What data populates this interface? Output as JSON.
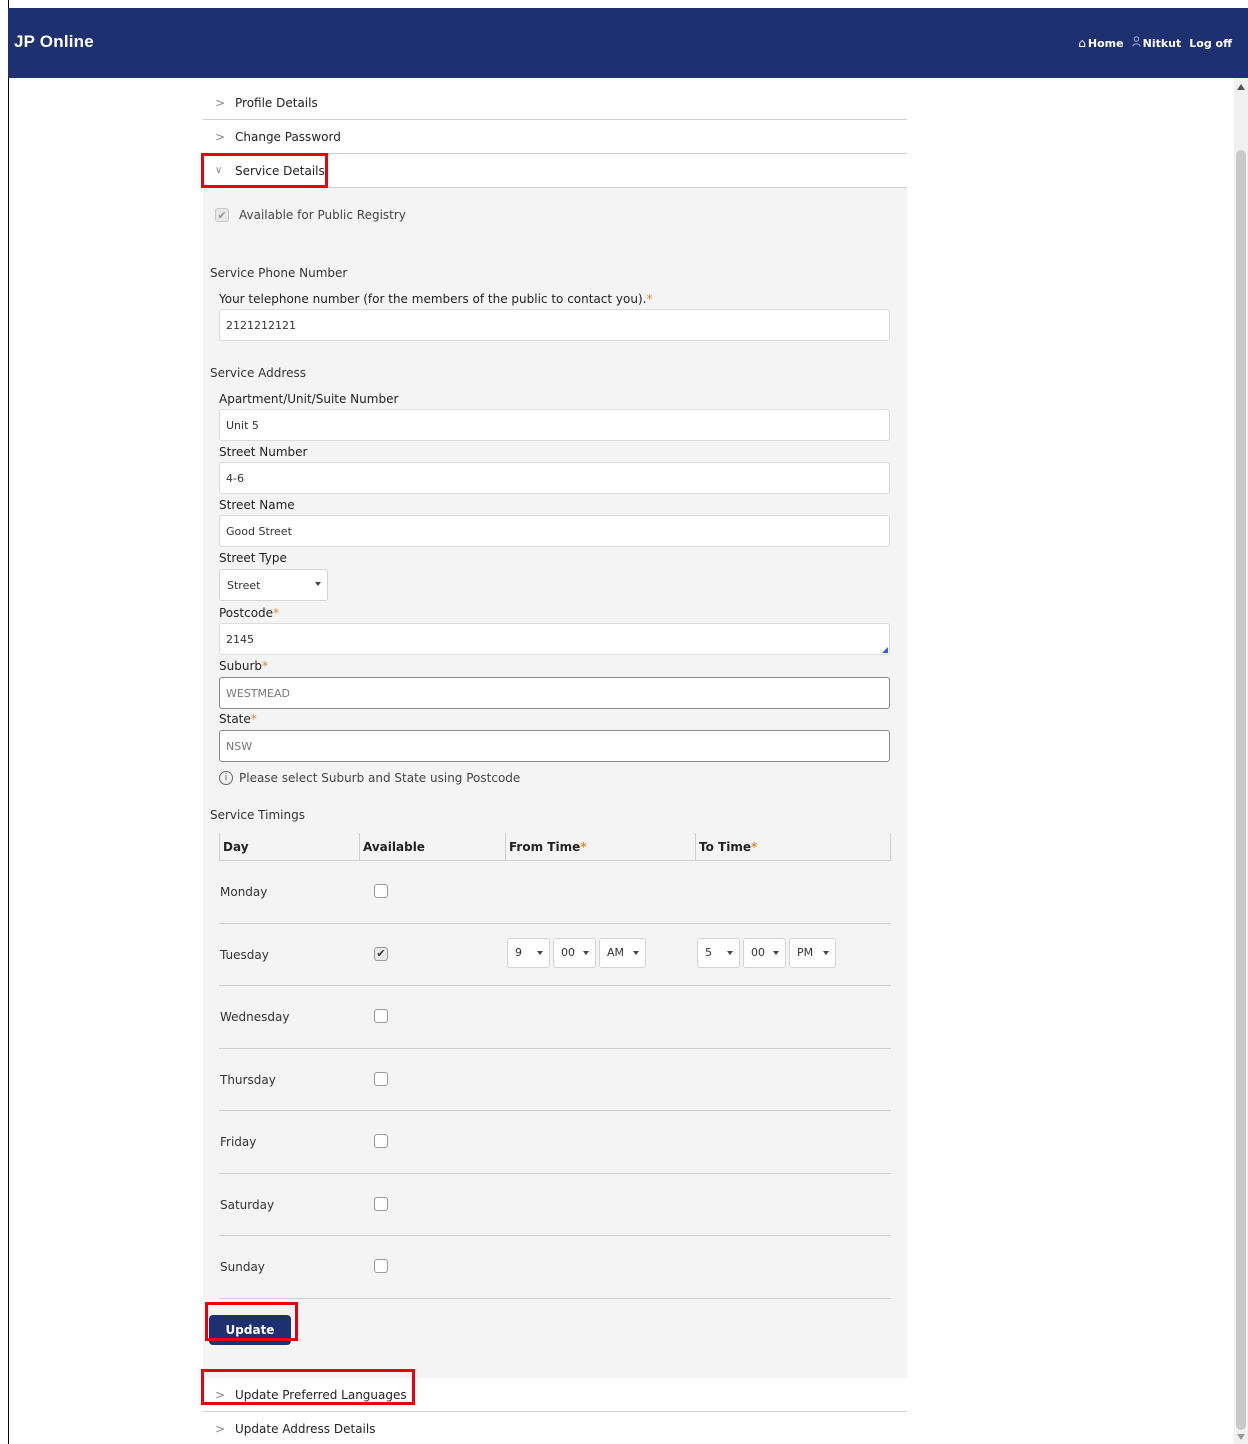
{
  "app": {
    "title": "JP Online"
  },
  "topnav": {
    "home_icon": "⌂",
    "home": "Home",
    "user_icon": "user-icon",
    "user": "Nitkut",
    "logoff": "Log off"
  },
  "accordion": {
    "profile": "Profile Details",
    "password": "Change Password",
    "service": "Service Details",
    "languages": "Update Preferred Languages",
    "address": "Update Address Details"
  },
  "service": {
    "public_registry": "Available for Public Registry",
    "phone_section": "Service Phone Number",
    "phone_label": "Your telephone number (for the members of the public to contact you).",
    "phone_value": "2121212121",
    "address_section": "Service Address",
    "unit_label": "Apartment/Unit/Suite Number",
    "unit_value": "Unit 5",
    "street_number_label": "Street Number",
    "street_number_value": "4-6",
    "street_name_label": "Street Name",
    "street_name_value": "Good Street",
    "street_type_label": "Street Type",
    "street_type_value": "Street",
    "postcode_label": "Postcode",
    "postcode_value": "2145",
    "suburb_label": "Suburb",
    "suburb_value": "WESTMEAD",
    "state_label": "State",
    "state_value": "NSW",
    "hint": "Please select Suburb and State using Postcode",
    "timings_section": "Service Timings",
    "required_mark": "*"
  },
  "timings": {
    "headers": {
      "day": "Day",
      "available": "Available",
      "from": "From Time",
      "to": "To Time"
    },
    "rows": [
      {
        "day": "Monday",
        "available": false
      },
      {
        "day": "Tuesday",
        "available": true,
        "from_hour": "9",
        "from_min": "00",
        "from_ampm": "AM",
        "to_hour": "5",
        "to_min": "00",
        "to_ampm": "PM"
      },
      {
        "day": "Wednesday",
        "available": false
      },
      {
        "day": "Thursday",
        "available": false
      },
      {
        "day": "Friday",
        "available": false
      },
      {
        "day": "Saturday",
        "available": false
      },
      {
        "day": "Sunday",
        "available": false
      }
    ]
  },
  "buttons": {
    "update": "Update"
  },
  "colors": {
    "brand": "#1f3070",
    "highlight": "#e8000d",
    "required": "#e08a2c"
  }
}
